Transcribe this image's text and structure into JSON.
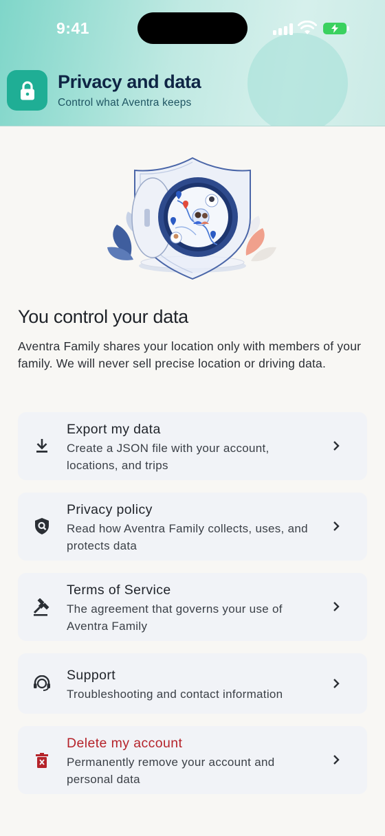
{
  "status_bar": {
    "time": "9:41"
  },
  "header": {
    "icon": "lock-icon",
    "title": "Privacy and data",
    "subtitle": "Control what Aventra keeps"
  },
  "hero": {
    "illustration": "shield-vault-family-map-illustration"
  },
  "main": {
    "title": "You control your data",
    "description": "Aventra Family shares your location only with members of your family. We will never sell precise location or driving data."
  },
  "items": [
    {
      "icon": "download-icon",
      "title": "Export my data",
      "description": "Create a JSON file with your account, locations, and trips"
    },
    {
      "icon": "shield-search-icon",
      "title": "Privacy policy",
      "description": "Read how Aventra Family collects, uses, and protects data"
    },
    {
      "icon": "gavel-icon",
      "title": "Terms of Service",
      "description": "The agreement that governs your use of Aventra Family"
    },
    {
      "icon": "support-agent-icon",
      "title": "Support",
      "description": "Troubleshooting and contact information"
    },
    {
      "icon": "delete-icon",
      "title": "Delete my account",
      "description": "Permanently remove your account and personal data"
    }
  ],
  "colors": {
    "accent": "#1fae95",
    "danger": "#b5232a",
    "title_navy": "#0f2545",
    "card_bg": "#f1f3f7"
  }
}
